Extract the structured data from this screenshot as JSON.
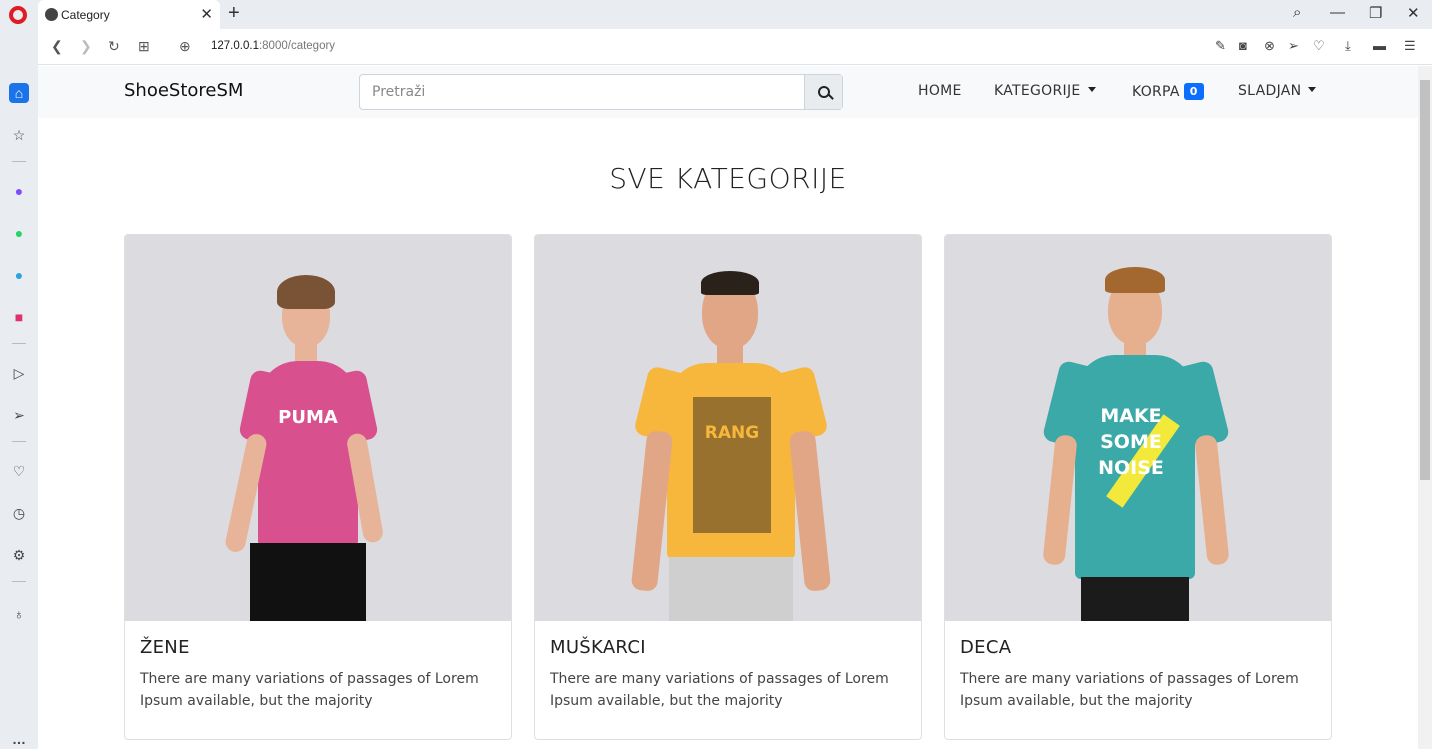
{
  "browser": {
    "tab_title": "Category",
    "url_host": "127.0.0.1",
    "url_rest": ":8000/category"
  },
  "navbar": {
    "brand": "ShoeStoreSM",
    "search_placeholder": "Pretraži",
    "links": {
      "home": "HOME",
      "categories": "KATEGORIJE",
      "cart": "KORPA",
      "cart_count": "0",
      "user": "SLADJAN"
    }
  },
  "page": {
    "heading": "SVE KATEGORIJE"
  },
  "categories": [
    {
      "name": "ŽENE",
      "description": "There are many variations of passages of Lorem Ipsum available, but the majority",
      "shirt_print": "PUMA",
      "shirt_color": "#d9508f"
    },
    {
      "name": "MUŠKARCI",
      "description": "There are many variations of passages of Lorem Ipsum available, but the majority",
      "shirt_print": "RANG",
      "shirt_color": "#f6b73c"
    },
    {
      "name": "DECA",
      "description": "There are many variations of passages of Lorem Ipsum available, but the majority",
      "shirt_print": "MAKE SOME NOISE",
      "shirt_color": "#3aa9a7"
    }
  ],
  "colors": {
    "accent": "#0d6efd",
    "opera_red": "#e01b24"
  }
}
